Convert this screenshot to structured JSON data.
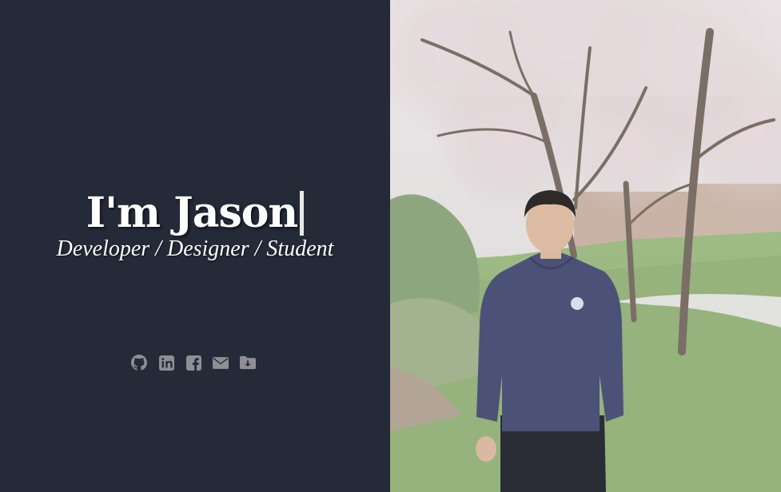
{
  "hero": {
    "headline": "I'm Jason",
    "tagline": "Developer / Designer / Student"
  },
  "socials": [
    {
      "icon": "github-icon"
    },
    {
      "icon": "linkedin-icon"
    },
    {
      "icon": "facebook-icon"
    },
    {
      "icon": "envelope-icon"
    },
    {
      "icon": "folder-download-icon"
    }
  ],
  "colors": {
    "panel_bg": "#252a38",
    "icon": "#8d8f95",
    "text": "#ffffff"
  }
}
